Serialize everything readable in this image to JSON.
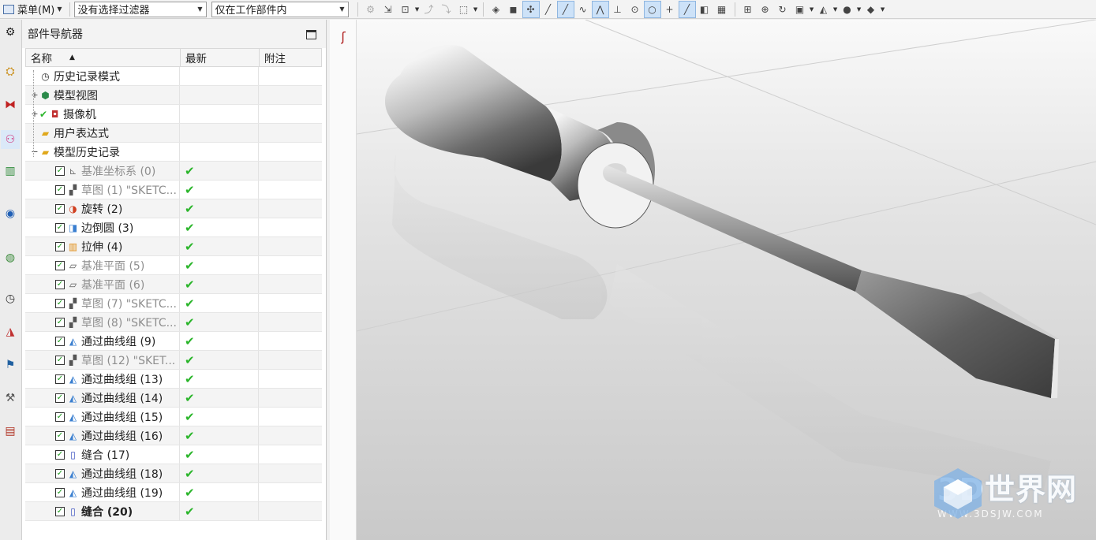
{
  "toolbar": {
    "menu_label": "菜单(M)",
    "filter_value": "没有选择过滤器",
    "scope_value": "仅在工作部件内"
  },
  "navigator": {
    "title": "部件导航器",
    "columns": [
      "名称",
      "最新",
      "附注"
    ],
    "nodes": [
      {
        "label": "历史记录模式",
        "icon": "clock-icon"
      },
      {
        "label": "模型视图",
        "icon": "model-views-icon",
        "expander": "+"
      },
      {
        "label": "摄像机",
        "icon": "camera-icon",
        "expander": "+",
        "check": "✔"
      },
      {
        "label": "用户表达式",
        "icon": "folder-icon"
      },
      {
        "label": "模型历史记录",
        "icon": "folder-open-icon",
        "expander": "−"
      }
    ],
    "features": [
      {
        "label": "基准坐标系 (0)",
        "grey": true,
        "latest": "✔",
        "icon": "datum-csys-icon"
      },
      {
        "label": "草图 (1) \"SKETC...",
        "grey": true,
        "latest": "✔",
        "icon": "sketch-icon"
      },
      {
        "label": "旋转 (2)",
        "grey": false,
        "latest": "✔",
        "icon": "revolve-icon"
      },
      {
        "label": "边倒圆 (3)",
        "grey": false,
        "latest": "✔",
        "icon": "edge-blend-icon"
      },
      {
        "label": "拉伸 (4)",
        "grey": false,
        "latest": "✔",
        "icon": "extrude-icon"
      },
      {
        "label": "基准平面 (5)",
        "grey": true,
        "latest": "✔",
        "icon": "datum-plane-icon"
      },
      {
        "label": "基准平面 (6)",
        "grey": true,
        "latest": "✔",
        "icon": "datum-plane-icon"
      },
      {
        "label": "草图 (7) \"SKETC...",
        "grey": true,
        "latest": "✔",
        "icon": "sketch-icon"
      },
      {
        "label": "草图 (8) \"SKETC...",
        "grey": true,
        "latest": "✔",
        "icon": "sketch-icon"
      },
      {
        "label": "通过曲线组 (9)",
        "grey": false,
        "latest": "✔",
        "icon": "through-curves-icon"
      },
      {
        "label": "草图 (12) \"SKET...",
        "grey": true,
        "latest": "✔",
        "icon": "sketch-icon"
      },
      {
        "label": "通过曲线组 (13)",
        "grey": false,
        "latest": "✔",
        "icon": "through-curves-icon"
      },
      {
        "label": "通过曲线组 (14)",
        "grey": false,
        "latest": "✔",
        "icon": "through-curves-icon"
      },
      {
        "label": "通过曲线组 (15)",
        "grey": false,
        "latest": "✔",
        "icon": "through-curves-icon"
      },
      {
        "label": "通过曲线组 (16)",
        "grey": false,
        "latest": "✔",
        "icon": "through-curves-icon"
      },
      {
        "label": "缝合 (17)",
        "grey": false,
        "latest": "✔",
        "icon": "sew-icon"
      },
      {
        "label": "通过曲线组 (18)",
        "grey": false,
        "latest": "✔",
        "icon": "through-curves-icon"
      },
      {
        "label": "通过曲线组 (19)",
        "grey": false,
        "latest": "✔",
        "icon": "through-curves-icon"
      },
      {
        "label": "缝合 (20)",
        "grey": false,
        "bold": true,
        "latest": "✔",
        "icon": "sew-icon"
      }
    ]
  },
  "viewport": {
    "model": "screwdriver",
    "watermark_main": "3D世界网",
    "watermark_sub": "WWW.3DSJW.COM"
  },
  "colors": {
    "accent_check": "#2ab52a",
    "viewport_top": "#f9f9f9",
    "viewport_bottom": "#c9c9c9",
    "watermark": "#7fb2e5"
  }
}
